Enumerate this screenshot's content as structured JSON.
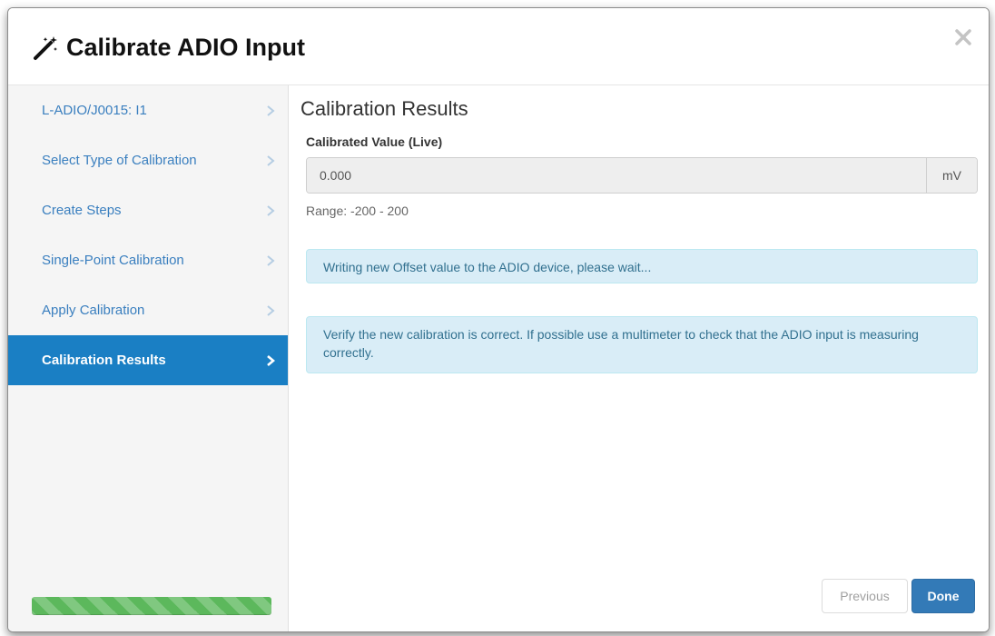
{
  "dialog": {
    "title": "Calibrate ADIO Input",
    "icon": "magic-wand-icon",
    "close_icon": "close-icon"
  },
  "sidebar": {
    "steps": [
      {
        "label": "L-ADIO/J0015: I1",
        "active": false
      },
      {
        "label": "Select Type of Calibration",
        "active": false
      },
      {
        "label": "Create Steps",
        "active": false
      },
      {
        "label": "Single-Point Calibration",
        "active": false
      },
      {
        "label": "Apply Calibration",
        "active": false
      },
      {
        "label": "Calibration Results",
        "active": true
      }
    ],
    "progress": 1.0
  },
  "main": {
    "section_title": "Calibration Results",
    "field_label": "Calibrated Value (Live)",
    "field_value": "0.000",
    "field_unit": "mV",
    "range_text": "Range: -200 - 200",
    "alert_writing": "Writing new Offset value to the ADIO device, please wait...",
    "alert_verify": "Verify the new calibration is correct. If possible use a multimeter to check that the ADIO input is measuring correctly."
  },
  "footer": {
    "previous_label": "Previous",
    "done_label": "Done"
  },
  "colors": {
    "active_step_bg": "#1a7fc4",
    "step_link": "#3a7fbf",
    "progress": "#5cb85c",
    "alert_bg": "#d9edf7",
    "done_button": "#337ab7"
  }
}
